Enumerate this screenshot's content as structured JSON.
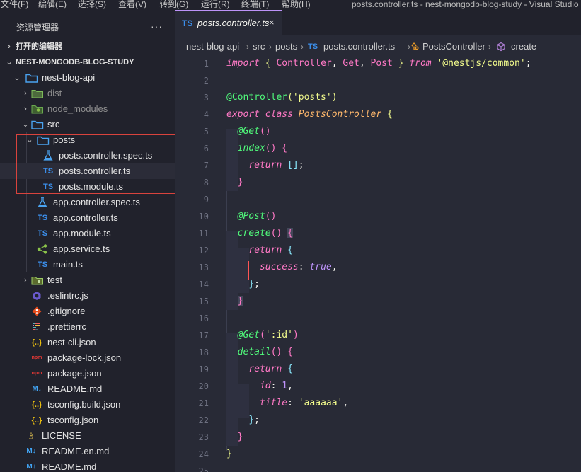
{
  "menubar": {
    "items": [
      "文件(F)",
      "编辑(E)",
      "选择(S)",
      "查看(V)",
      "转到(G)",
      "运行(R)",
      "终端(T)",
      "帮助(H)"
    ],
    "window_title": "posts.controller.ts - nest-mongodb-blog-study - Visual Studio"
  },
  "sidebar": {
    "title": "资源管理器",
    "more": "···",
    "open_editors": "打开的编辑器",
    "workspace": "NEST-MONGODB-BLOG-STUDY",
    "tree": [
      {
        "label": "nest-blog-api",
        "type": "folder-open",
        "depth": 1
      },
      {
        "label": "dist",
        "type": "folder",
        "depth": 2
      },
      {
        "label": "node_modules",
        "type": "node-folder",
        "depth": 2,
        "dim": true
      },
      {
        "label": "src",
        "type": "folder-open",
        "depth": 2
      },
      {
        "label": "posts",
        "type": "folder-open",
        "depth": 3
      },
      {
        "label": "posts.controller.spec.ts",
        "type": "test",
        "depth": 4
      },
      {
        "label": "posts.controller.ts",
        "type": "ts",
        "depth": 4,
        "selected": true
      },
      {
        "label": "posts.module.ts",
        "type": "ts",
        "depth": 4
      },
      {
        "label": "app.controller.spec.ts",
        "type": "test",
        "depth": 3
      },
      {
        "label": "app.controller.ts",
        "type": "ts",
        "depth": 3
      },
      {
        "label": "app.module.ts",
        "type": "ts",
        "depth": 3
      },
      {
        "label": "app.service.ts",
        "type": "service",
        "depth": 3
      },
      {
        "label": "main.ts",
        "type": "ts",
        "depth": 3
      },
      {
        "label": "test",
        "type": "test-folder",
        "depth": 2
      },
      {
        "label": ".eslintrc.js",
        "type": "eslint",
        "depth": 2
      },
      {
        "label": ".gitignore",
        "type": "git",
        "depth": 2
      },
      {
        "label": ".prettierrc",
        "type": "prettier",
        "depth": 2
      },
      {
        "label": "nest-cli.json",
        "type": "json",
        "depth": 2
      },
      {
        "label": "package-lock.json",
        "type": "npm",
        "depth": 2
      },
      {
        "label": "package.json",
        "type": "npm",
        "depth": 2
      },
      {
        "label": "README.md",
        "type": "md",
        "depth": 2
      },
      {
        "label": "tsconfig.build.json",
        "type": "json",
        "depth": 2
      },
      {
        "label": "tsconfig.json",
        "type": "json",
        "depth": 2
      },
      {
        "label": "LICENSE",
        "type": "license",
        "depth": 1
      },
      {
        "label": "README.en.md",
        "type": "md",
        "depth": 1
      },
      {
        "label": "README.md",
        "type": "md",
        "depth": 1
      }
    ]
  },
  "editor": {
    "tab": {
      "icon": "TS",
      "label": "posts.controller.ts",
      "close": "×"
    },
    "breadcrumb": [
      "nest-blog-api",
      "src",
      "posts",
      "posts.controller.ts",
      "PostsController",
      "create"
    ],
    "line_numbers": [
      "1",
      "2",
      "3",
      "4",
      "5",
      "6",
      "7",
      "8",
      "9",
      "10",
      "11",
      "12",
      "13",
      "14",
      "15",
      "16",
      "17",
      "18",
      "19",
      "20",
      "21",
      "22",
      "23",
      "24",
      "25"
    ]
  },
  "colors": {
    "editor_bg": "#282a36",
    "sidebar_bg": "#21222c",
    "keyword": "#ff79c6",
    "string": "#f1fa8c",
    "function": "#50fa7b",
    "class": "#8be9fd",
    "number": "#bd93f9",
    "ts_icon": "#3b8eea",
    "highlight_border": "#d9433d"
  }
}
